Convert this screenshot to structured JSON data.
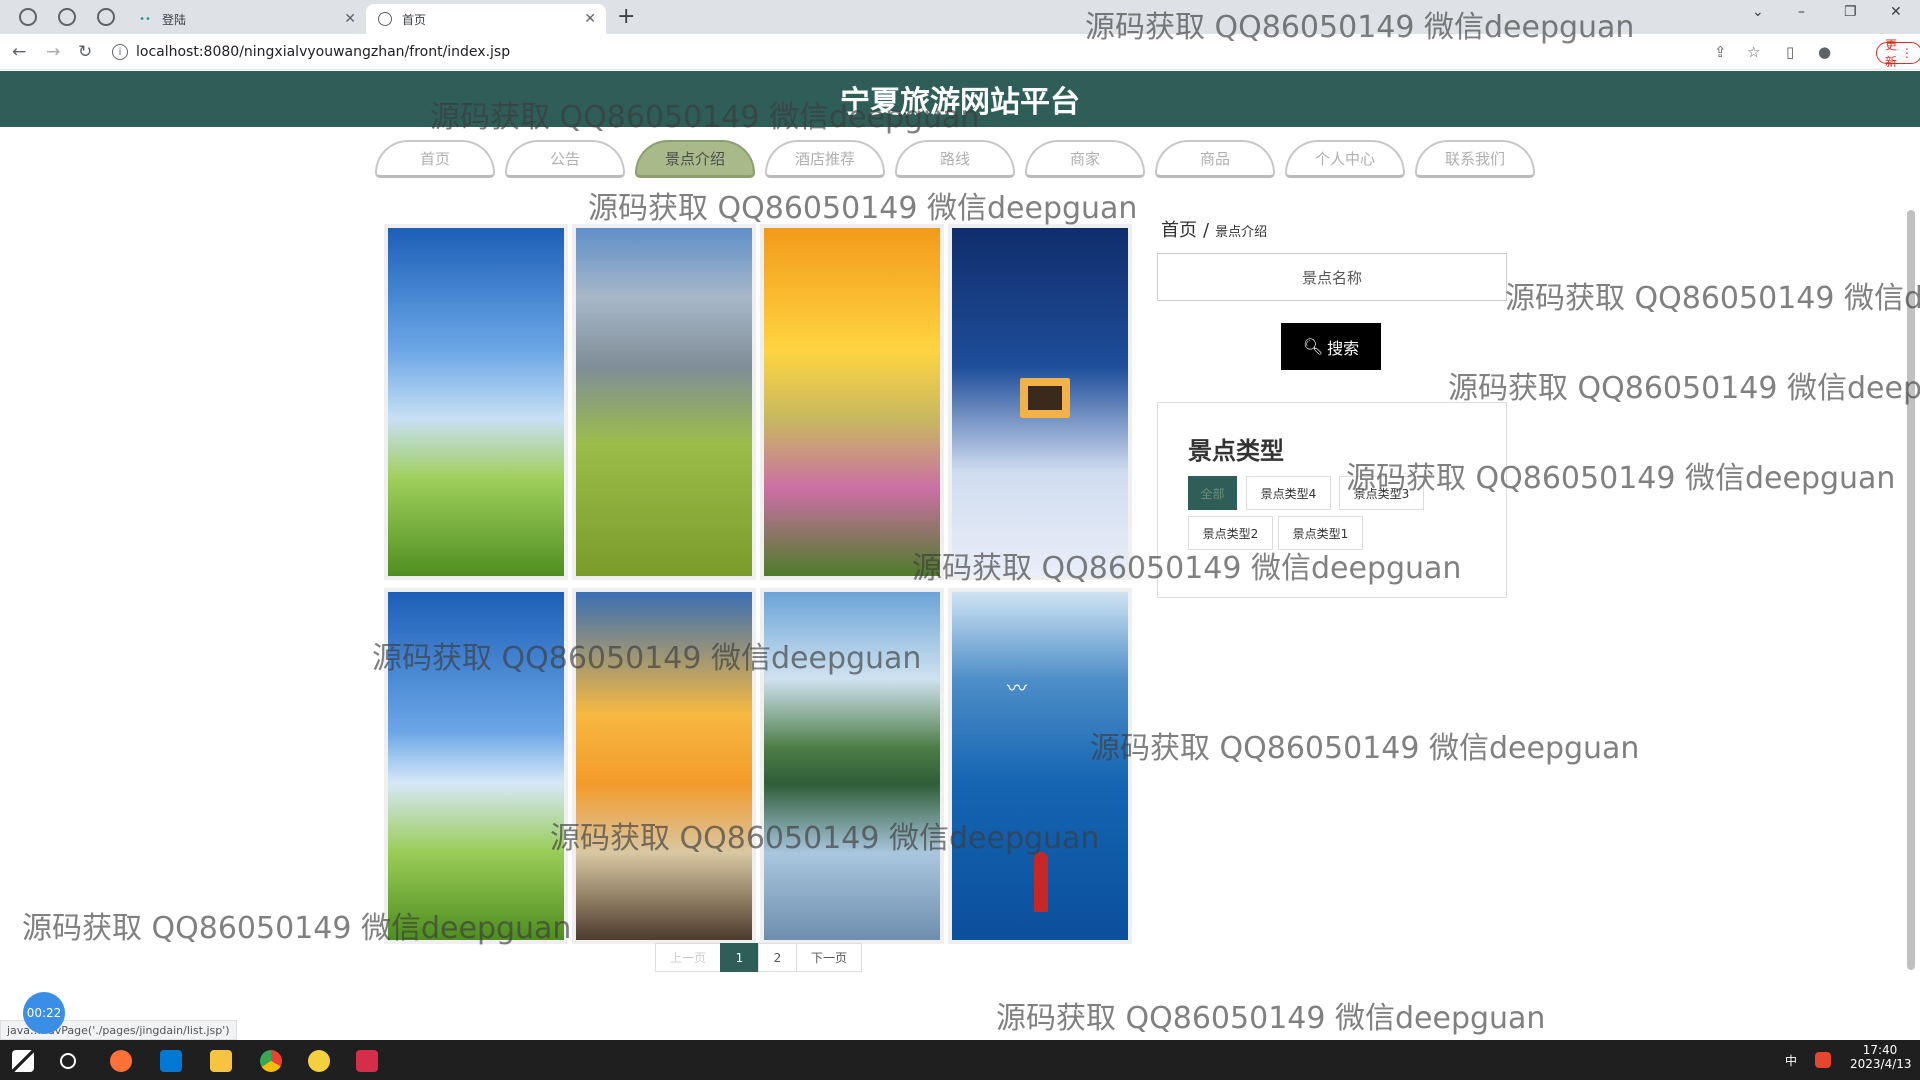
{
  "browser": {
    "tabs": [
      {
        "title": "登陆"
      },
      {
        "title": "首页"
      }
    ],
    "url": "localhost:8080/ningxialvyouwangzhan/front/index.jsp",
    "update_label": "更新",
    "status_url": "java…navPage('./pages/jingdain/list.jsp')"
  },
  "site": {
    "title": "宁夏旅游网站平台",
    "nav": [
      {
        "label": "首页"
      },
      {
        "label": "公告"
      },
      {
        "label": "景点介绍",
        "active": true
      },
      {
        "label": "酒店推荐"
      },
      {
        "label": "路线"
      },
      {
        "label": "商家"
      },
      {
        "label": "商品"
      },
      {
        "label": "个人中心"
      },
      {
        "label": "联系我们"
      }
    ]
  },
  "breadcrumb": {
    "home": "首页",
    "sep": "/",
    "current": "景点介绍"
  },
  "search": {
    "placeholder": "景点名称",
    "button": "搜索"
  },
  "types": {
    "title": "景点类型",
    "chips": [
      "全部",
      "景点类型4",
      "景点类型3",
      "景点类型2",
      "景点类型1"
    ]
  },
  "pager": {
    "prev": "上一页",
    "pages": [
      "1",
      "2"
    ],
    "current": "1",
    "next": "下一页"
  },
  "timer": "00:22",
  "watermark": "源码获取 QQ86050149 微信deepguan",
  "taskbar": {
    "time": "17:40",
    "date": "2023/4/13",
    "ime": "中"
  },
  "colors": {
    "header": "#2f5d57",
    "nav_active": "#a8b98a",
    "search_button": "#000000"
  }
}
